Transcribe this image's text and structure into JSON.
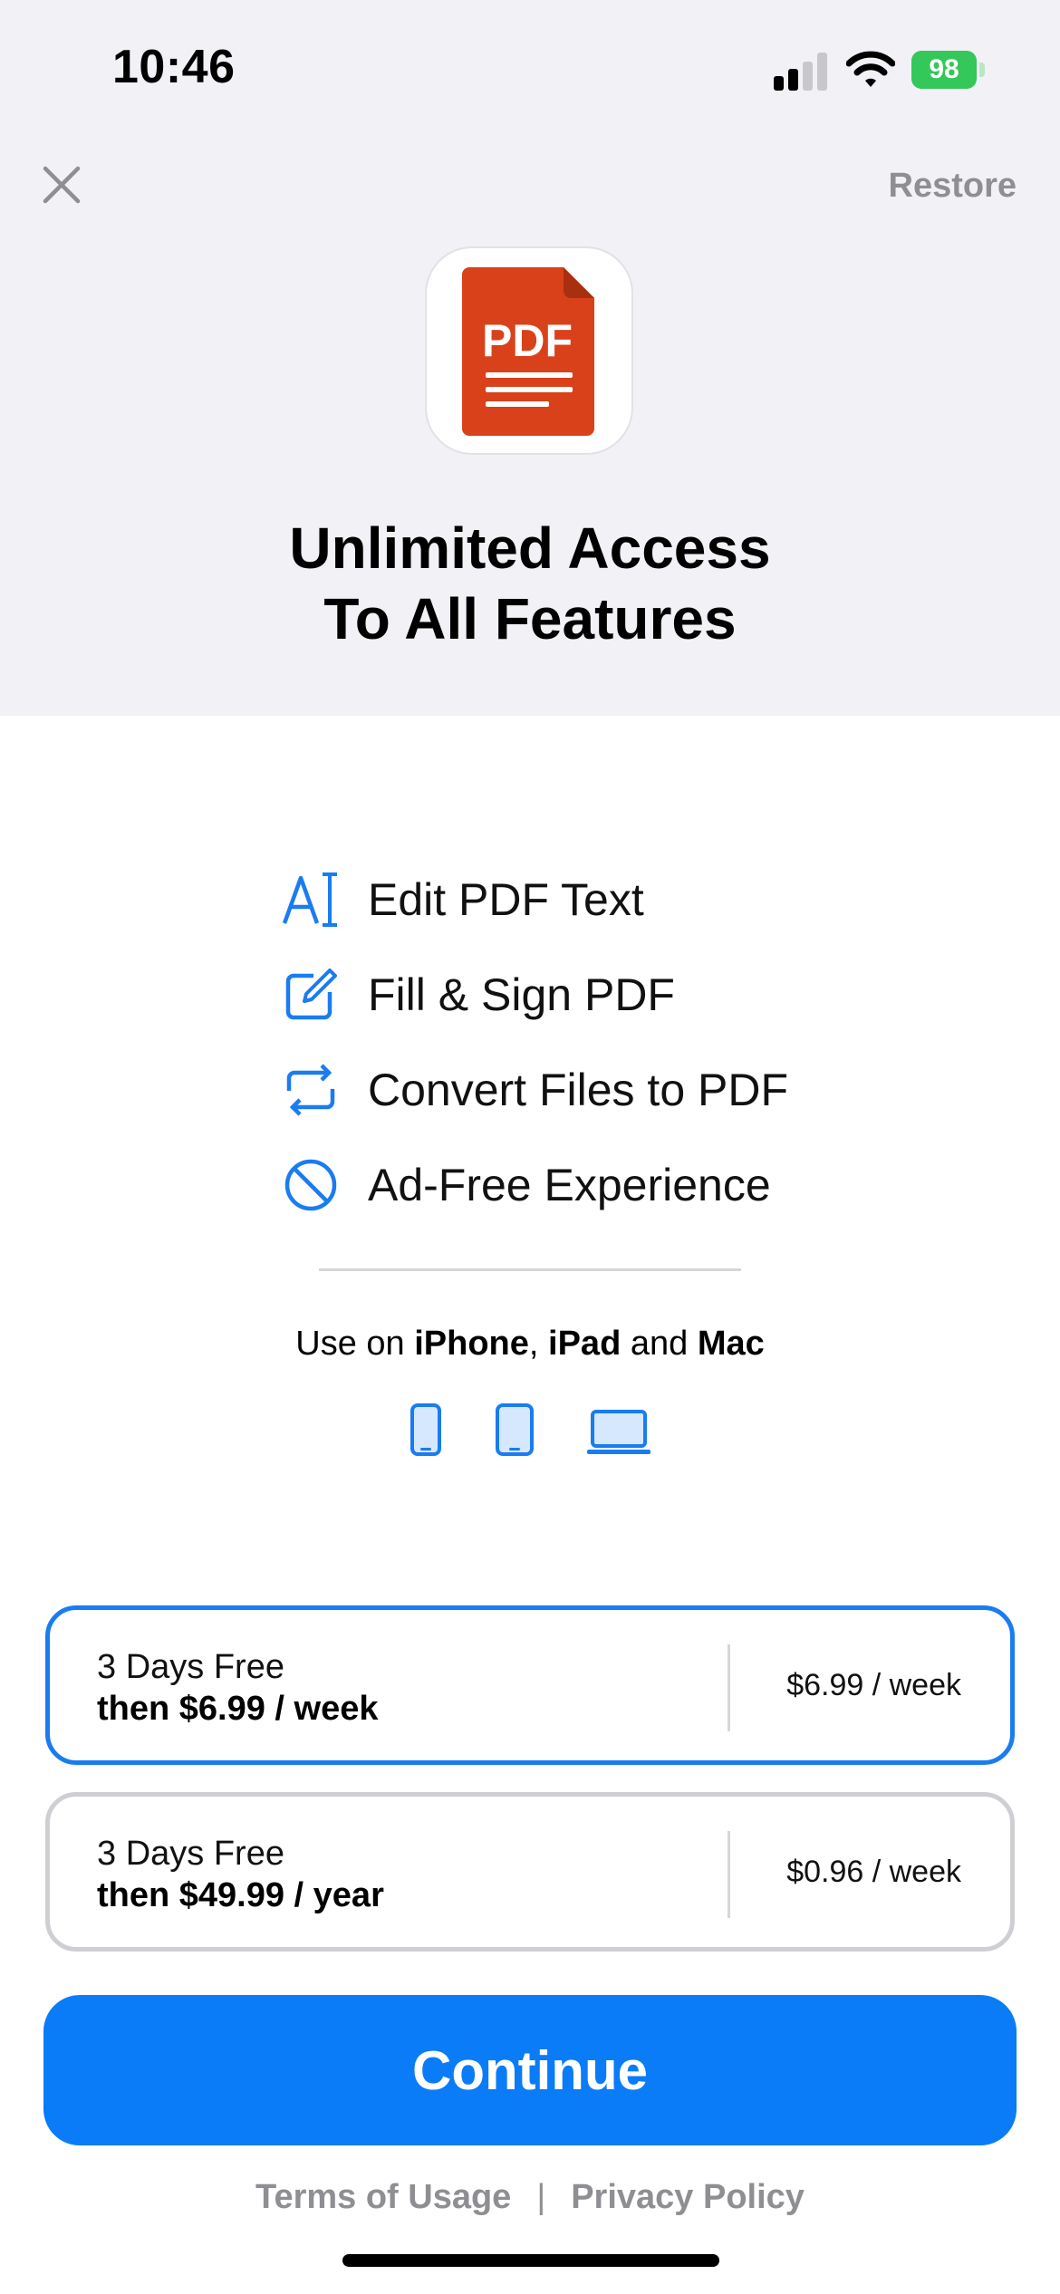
{
  "status_bar": {
    "time": "10:46",
    "battery_level": "98"
  },
  "header": {
    "restore_label": "Restore",
    "app_icon_text": "PDF",
    "headline_line1": "Unlimited Access",
    "headline_line2": "To All Features"
  },
  "features": [
    {
      "icon": "text-cursor-icon",
      "label": "Edit PDF Text"
    },
    {
      "icon": "pencil-square-icon",
      "label": "Fill & Sign PDF"
    },
    {
      "icon": "convert-arrows-icon",
      "label": "Convert Files to PDF"
    },
    {
      "icon": "no-ads-icon",
      "label": "Ad-Free Experience"
    }
  ],
  "platforms": {
    "prefix": "Use on ",
    "device1": "iPhone",
    "comma": ", ",
    "device2": "iPad",
    "and": " and ",
    "device3": "Mac"
  },
  "plans": [
    {
      "trial": "3 Days Free",
      "then": "then $6.99 / week",
      "price": "$6.99 / week",
      "selected": true
    },
    {
      "trial": "3 Days Free",
      "then": "then $49.99 / year",
      "price": "$0.96 / week",
      "selected": false
    }
  ],
  "continue_label": "Continue",
  "footer": {
    "terms": "Terms of Usage",
    "separator": "|",
    "privacy": "Privacy Policy"
  },
  "colors": {
    "accent": "#0a7cf7",
    "battery": "#34c759",
    "pdf_red": "#d9411a"
  }
}
